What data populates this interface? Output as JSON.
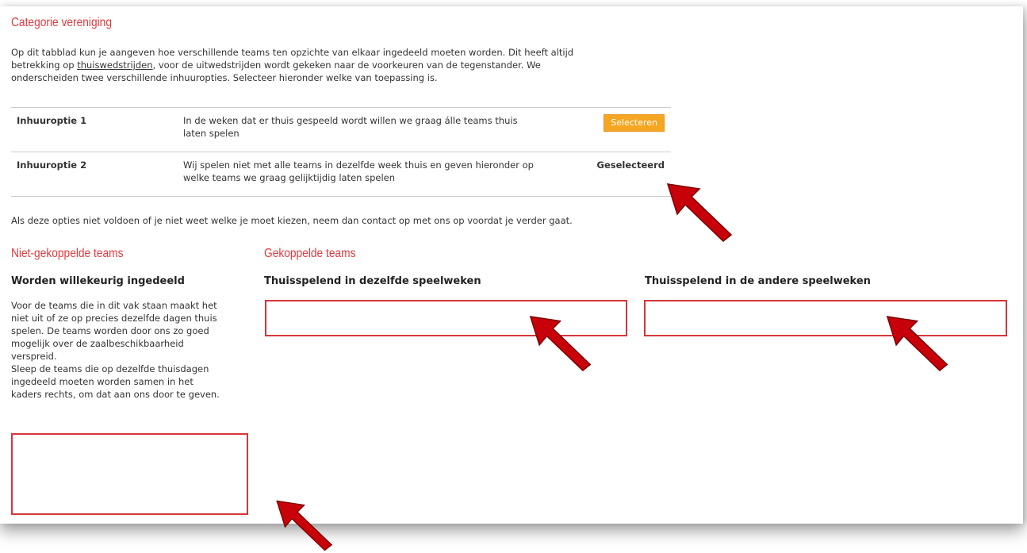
{
  "section_title": "Categorie vereniging",
  "intro": {
    "line1": "Op dit tabblad kun je aangeven hoe verschillende teams ten opzichte van elkaar ingedeeld moeten worden. Dit heeft altijd",
    "line2_pre": "betrekking op ",
    "line2_link": "thuiswedstrijden",
    "line2_post": ", voor de uitwedstrijden wordt gekeken naar de voorkeuren van de tegenstander. We",
    "line3": "onderscheiden twee verschillende inhuuropties. Selecteer hieronder welke van toepassing is."
  },
  "options": [
    {
      "label": "Inhuuroptie 1",
      "description_l1": "In de weken dat er thuis gespeeld wordt willen we graag álle teams thuis",
      "description_l2": "laten spelen",
      "action": "Selecteren"
    },
    {
      "label": "Inhuuroptie 2",
      "description_l1": "Wij spelen niet met alle teams in dezelfde week thuis en geven hieronder op",
      "description_l2": "welke teams we graag gelijktijdig laten spelen",
      "status": "Geselecteerd"
    }
  ],
  "contact_note": "Als deze opties niet voldoen of je niet weet welke je moet kiezen, neem dan contact op met ons op voordat je verder gaat.",
  "unlinked": {
    "title": "Niet-gekoppelde teams",
    "subtitle": "Worden willekeurig ingedeeld",
    "desc": [
      "Voor de teams die in dit vak staan maakt het",
      "niet uit of ze op precies dezelfde dagen thuis",
      "spelen. De teams worden door ons zo goed",
      "mogelijk over de zaalbeschikbaarheid",
      "verspreid.",
      "Sleep de teams die op dezelfde thuisdagen",
      "ingedeeld moeten worden samen in het",
      "kaders rechts, om dat aan ons door te geven."
    ]
  },
  "linked": {
    "title": "Gekoppelde teams",
    "col1_title": "Thuisspelend in dezelfde speelweken",
    "col2_title": "Thuisspelend in de andere speelweken"
  },
  "colors": {
    "accent_red": "#e03a3e",
    "button_orange": "#f5a623",
    "arrow_red": "#cc0000"
  }
}
